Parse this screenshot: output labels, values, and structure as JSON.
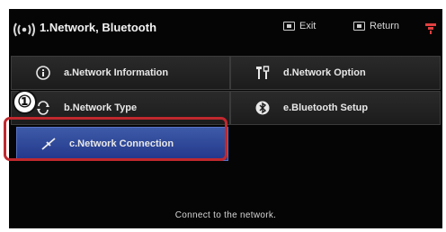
{
  "header": {
    "title": "1.Network, Bluetooth",
    "exit_label": "Exit",
    "return_label": "Return",
    "icons": [
      "network-icon",
      "exit-key-icon",
      "return-key-icon",
      "settings-icon"
    ]
  },
  "menu": {
    "items": [
      {
        "label": "a.Network Information",
        "icon": "info-icon"
      },
      {
        "label": "b.Network Type",
        "icon": "network-type-icon"
      },
      {
        "label": "c.Network Connection",
        "icon": "connection-icon",
        "selected": true
      },
      {
        "label": "d.Network Option",
        "icon": "tools-icon"
      },
      {
        "label": "e.Bluetooth Setup",
        "icon": "bluetooth-icon"
      }
    ]
  },
  "annotation": {
    "step_marker": "①"
  },
  "footer": {
    "hint": "Connect to the network."
  },
  "colors": {
    "highlight_border": "#c0282e",
    "selected_button": "#2f47a0",
    "background": "#050505"
  }
}
